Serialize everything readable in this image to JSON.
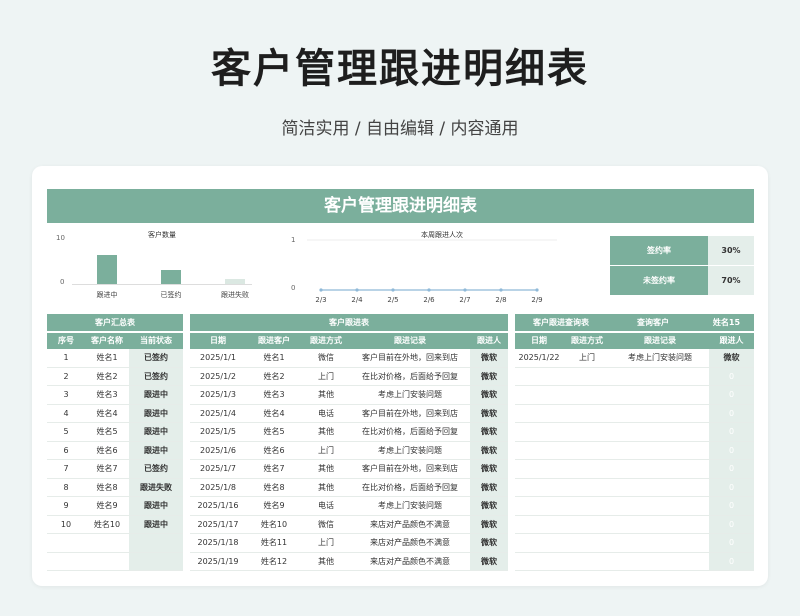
{
  "page": {
    "title": "客户管理跟进明细表",
    "subtitle": "简洁实用 / 自由编辑 / 内容通用"
  },
  "sheet": {
    "title": "客户管理跟进明细表"
  },
  "colors": {
    "accent": "#7baf9c",
    "shade": "#e4eeea",
    "bar1": "#7baf9c",
    "bar2": "#7baf9c",
    "bar3": "#dbe8e2",
    "line": "#8fb9d8"
  },
  "bar_chart_data": {
    "type": "bar",
    "title": "客户数量",
    "categories": [
      "跟进中",
      "已签约",
      "跟进失败"
    ],
    "values": [
      6,
      3,
      1
    ],
    "ylim": [
      0,
      10
    ],
    "yticks": [
      "10",
      "0"
    ]
  },
  "line_chart_data": {
    "type": "line",
    "title": "本周跟进人次",
    "categories": [
      "2/3",
      "2/4",
      "2/5",
      "2/6",
      "2/7",
      "2/8",
      "2/9"
    ],
    "values": [
      0,
      0,
      0,
      0,
      0,
      0,
      0
    ],
    "ylim": [
      0,
      1
    ],
    "yticks": [
      "1",
      "0"
    ]
  },
  "rates": [
    {
      "label": "签约率",
      "value": "30%"
    },
    {
      "label": "未签约率",
      "value": "70%"
    }
  ],
  "summary": {
    "header": "客户汇总表",
    "columns": [
      "序号",
      "客户名称",
      "当前状态"
    ],
    "rows": [
      [
        "1",
        "姓名1",
        "已签约"
      ],
      [
        "2",
        "姓名2",
        "已签约"
      ],
      [
        "3",
        "姓名3",
        "跟进中"
      ],
      [
        "4",
        "姓名4",
        "跟进中"
      ],
      [
        "5",
        "姓名5",
        "跟进中"
      ],
      [
        "6",
        "姓名6",
        "跟进中"
      ],
      [
        "7",
        "姓名7",
        "已签约"
      ],
      [
        "8",
        "姓名8",
        "跟进失败"
      ],
      [
        "9",
        "姓名9",
        "跟进中"
      ],
      [
        "10",
        "姓名10",
        "跟进中"
      ],
      [
        "",
        "",
        ""
      ],
      [
        "",
        "",
        ""
      ]
    ]
  },
  "followup": {
    "header": "客户跟进表",
    "columns": [
      "日期",
      "跟进客户",
      "跟进方式",
      "跟进记录",
      "跟进人"
    ],
    "rows": [
      [
        "2025/1/1",
        "姓名1",
        "微信",
        "客户目前在外地，回来到店",
        "微软"
      ],
      [
        "2025/1/2",
        "姓名2",
        "上门",
        "在比对价格，后面给予回复",
        "微软"
      ],
      [
        "2025/1/3",
        "姓名3",
        "其他",
        "考虑上门安装问题",
        "微软"
      ],
      [
        "2025/1/4",
        "姓名4",
        "电话",
        "客户目前在外地，回来到店",
        "微软"
      ],
      [
        "2025/1/5",
        "姓名5",
        "其他",
        "在比对价格，后面给予回复",
        "微软"
      ],
      [
        "2025/1/6",
        "姓名6",
        "上门",
        "考虑上门安装问题",
        "微软"
      ],
      [
        "2025/1/7",
        "姓名7",
        "其他",
        "客户目前在外地，回来到店",
        "微软"
      ],
      [
        "2025/1/8",
        "姓名8",
        "其他",
        "在比对价格，后面给予回复",
        "微软"
      ],
      [
        "2025/1/16",
        "姓名9",
        "电话",
        "考虑上门安装问题",
        "微软"
      ],
      [
        "2025/1/17",
        "姓名10",
        "微信",
        "来店对产品颜色不满意",
        "微软"
      ],
      [
        "2025/1/18",
        "姓名11",
        "上门",
        "来店对产品颜色不满意",
        "微软"
      ],
      [
        "2025/1/19",
        "姓名12",
        "其他",
        "来店对产品颜色不满意",
        "微软"
      ]
    ]
  },
  "query": {
    "header": "客户跟进查询表",
    "query_label": "查询客户",
    "query_value": "姓名15",
    "columns": [
      "日期",
      "跟进方式",
      "跟进记录",
      "跟进人"
    ],
    "rows": [
      [
        "2025/1/22",
        "上门",
        "考虑上门安装问题",
        "微软"
      ],
      [
        "",
        "",
        "",
        "0"
      ],
      [
        "",
        "",
        "",
        "0"
      ],
      [
        "",
        "",
        "",
        "0"
      ],
      [
        "",
        "",
        "",
        "0"
      ],
      [
        "",
        "",
        "",
        "0"
      ],
      [
        "",
        "",
        "",
        "0"
      ],
      [
        "",
        "",
        "",
        "0"
      ],
      [
        "",
        "",
        "",
        "0"
      ],
      [
        "",
        "",
        "",
        "0"
      ],
      [
        "",
        "",
        "",
        "0"
      ],
      [
        "",
        "",
        "",
        "0"
      ]
    ]
  }
}
